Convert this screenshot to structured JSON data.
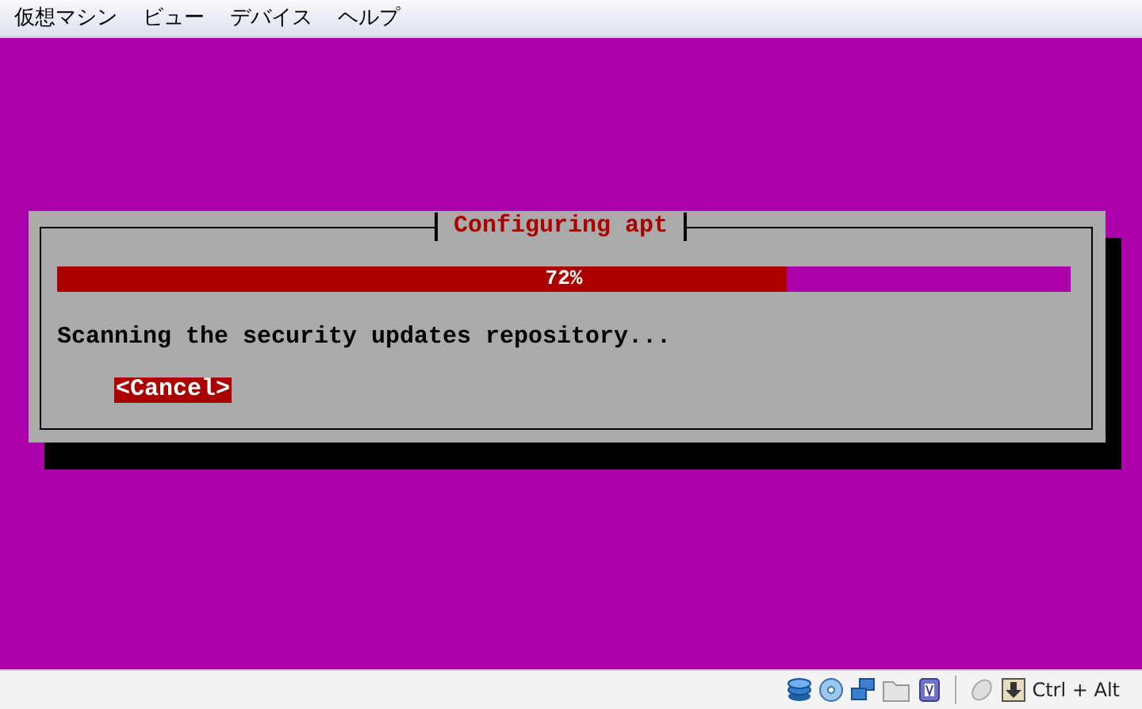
{
  "menu_bar": {
    "items": [
      {
        "label": "仮想マシン"
      },
      {
        "label": "ビュー"
      },
      {
        "label": "デバイス"
      },
      {
        "label": "ヘルプ"
      }
    ]
  },
  "dialog": {
    "title": "Configuring apt",
    "progress": {
      "level": 0.72,
      "label": "72%"
    },
    "message": "Scanning the security updates repository...",
    "buttons": [
      {
        "label": "<Cancel>",
        "selected": true
      }
    ]
  },
  "status_bar": {
    "host_key": "Ctrl + Alt"
  }
}
